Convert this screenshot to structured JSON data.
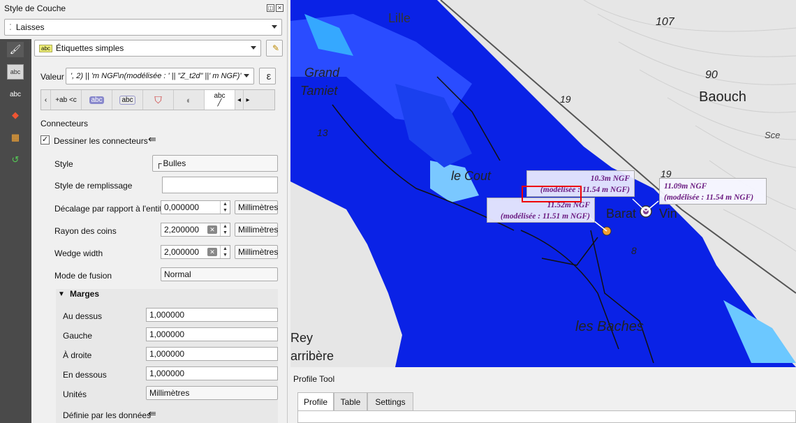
{
  "panel": {
    "title": "Style de Couche",
    "layer": "Laisses",
    "renderer": "Étiquettes simples",
    "value_label": "Valeur",
    "value_expr": "', 2) || 'm NGF\\n(modélisée : ' ||  \"Z_t2d\" ||' m NGF)'",
    "expression_btn": "ε",
    "section_connectors": "Connecteurs",
    "draw_connectors": "Dessiner les connecteurs",
    "style_label": "Style",
    "style_value": "Bulles",
    "fill_style_label": "Style de remplissage",
    "offset_label": "Décalage par rapport à l'entité",
    "offset_value": "0,000000",
    "units_mm": "Millimètres",
    "corner_label": "Rayon des coins",
    "corner_value": "2,200000",
    "wedge_label": "Wedge width",
    "wedge_value": "2,000000",
    "blend_label": "Mode de fusion",
    "blend_value": "Normal",
    "margins_label": "Marges",
    "margin_top_label": "Au dessus",
    "margin_top": "1,000000",
    "margin_left_label": "Gauche",
    "margin_left": "1,000000",
    "margin_right_label": "À droite",
    "margin_right": "1,000000",
    "margin_bottom_label": "En dessous",
    "margin_bottom": "1,000000",
    "units_label": "Unités",
    "units_value": "Millimètres",
    "data_defined_label": "Définie par les données"
  },
  "tabs_strip": [
    "+ab <c",
    "abc",
    "abc",
    "",
    "",
    "abc"
  ],
  "map": {
    "labels": [
      "Lille",
      "Grand",
      "Tamiet",
      "13",
      "le Cout",
      "19",
      "107",
      "90",
      "Baouch",
      "Sce",
      "19",
      "Barat",
      "Vin",
      "8",
      "les Baches",
      "Rey",
      "arribère"
    ],
    "callout1_line1": "10.3m NGF",
    "callout1_line2": "(modélisée : 11.54 m NGF)",
    "callout2_line1": "11.52m NGF",
    "callout2_line2": "(modélisée : 11.51 m NGF)",
    "callout3_line1": "11.09m NGF",
    "callout3_line2": "(modélisée : 11.54 m NGF)"
  },
  "profile": {
    "title": "Profile Tool",
    "tabs": [
      "Profile",
      "Table",
      "Settings"
    ]
  }
}
